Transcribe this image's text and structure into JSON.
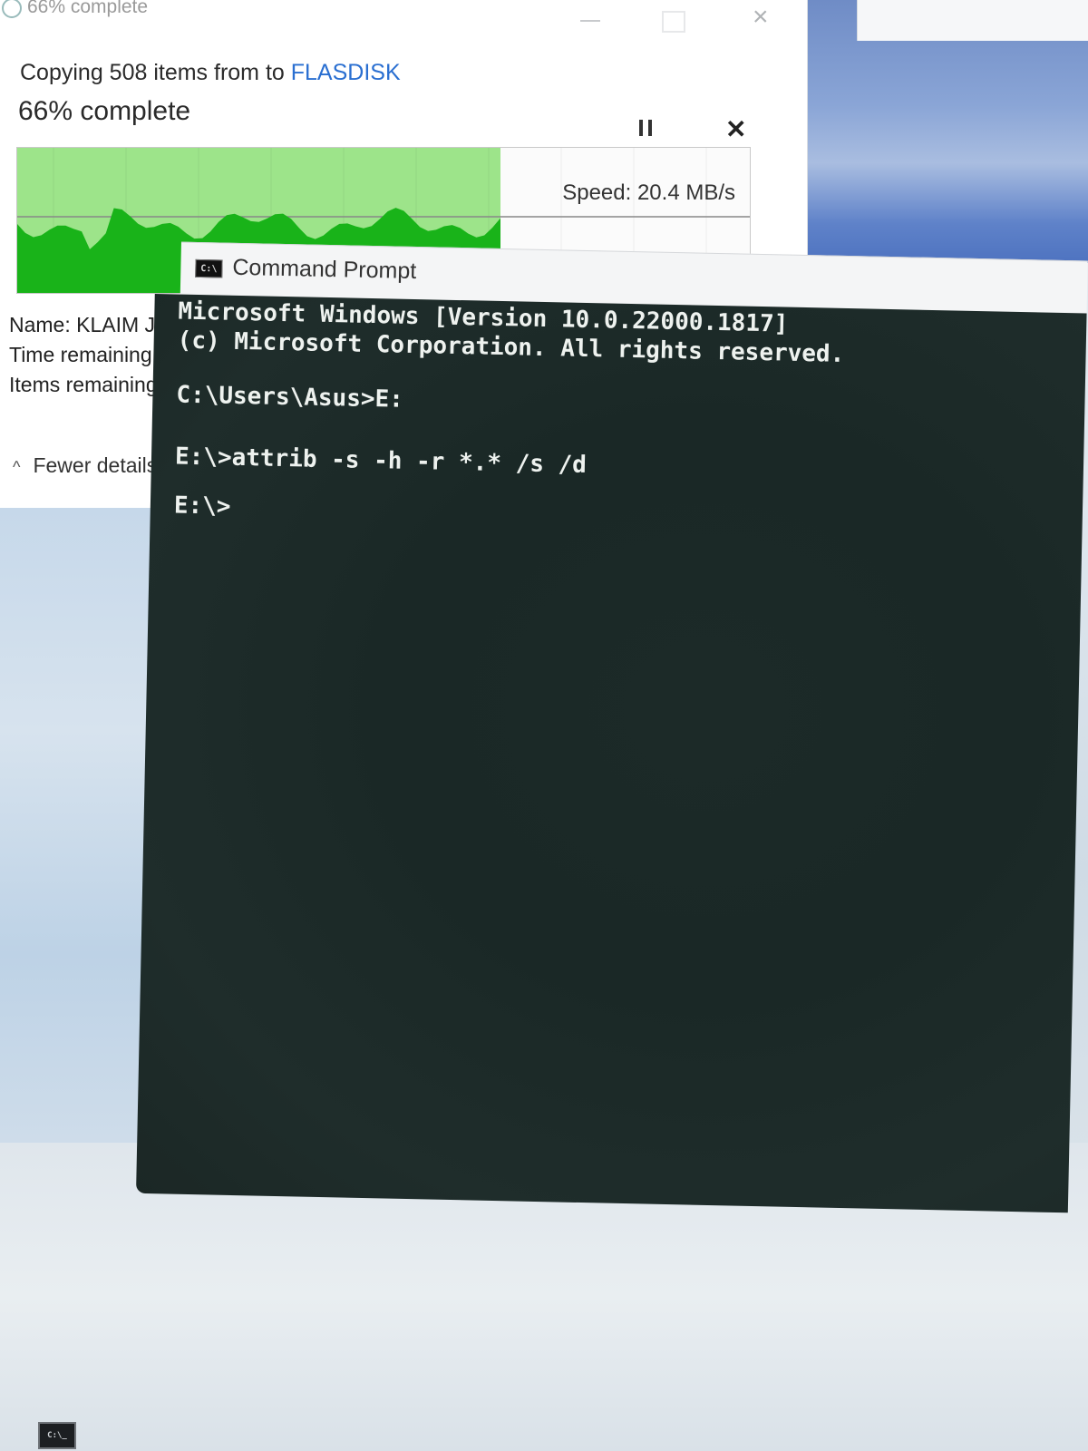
{
  "copy_dialog": {
    "titlebar_progress": "66% complete",
    "copy_text_prefix": "Copying 508 items from  to ",
    "destination": "FLASDISK",
    "percent_text": "66% complete",
    "progress_fraction": 0.66,
    "speed": "Speed: 20.4 MB/s",
    "name_label": "Name: KLAIM JP",
    "time_remaining_label": "Time remaining:",
    "items_remaining_label": "Items remaining:",
    "fewer_details": "Fewer details"
  },
  "cmd_window": {
    "title": "Command Prompt",
    "icon_text": "C:\\",
    "lines": [
      "Microsoft Windows [Version 10.0.22000.1817]",
      "(c) Microsoft Corporation. All rights reserved.",
      "C:\\Users\\Asus>E:",
      "E:\\>attrib -s -h -r *.* /s /d",
      "E:\\>"
    ]
  },
  "taskbar": {
    "cmd_icon_text": "C:\\_"
  },
  "colors": {
    "graph_fill": "#19b319",
    "graph_bg": "#9de48a",
    "destination_link": "#2a6fd1",
    "cmd_background": "#1c2a28"
  }
}
